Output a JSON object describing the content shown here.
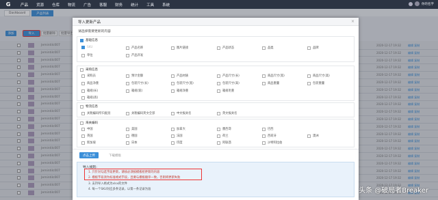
{
  "topnav": {
    "logo": "G",
    "items": [
      "产品",
      "货源",
      "仓库",
      "物流",
      "广告",
      "客服",
      "财务",
      "统计",
      "工具",
      "系统"
    ],
    "user": "你的名字"
  },
  "tabs": [
    "Dashboard",
    "产品列表"
  ],
  "toolbar": {
    "buttons": [
      "添加",
      "导入",
      "批量删除",
      "批量导出"
    ]
  },
  "background_rows": [
    {
      "code": "Jemintilc007",
      "date": "2020-12-17 19:32",
      "ops": "编辑 复制"
    },
    {
      "code": "Jemintilc007",
      "date": "2020-12-17 19:32",
      "ops": "编辑 复制"
    },
    {
      "code": "Jemintilc007",
      "date": "2020-12-17 19:32",
      "ops": "编辑 复制"
    },
    {
      "code": "Jemintilc007",
      "date": "2020-12-17 19:32",
      "ops": "编辑 复制"
    },
    {
      "code": "Jemintilc007",
      "date": "2020-12-17 19:32",
      "ops": "编辑 复制"
    },
    {
      "code": "Jemintilc007",
      "date": "2020-12-17 19:32",
      "ops": "编辑 复制"
    },
    {
      "code": "Jemintilc007",
      "date": "2020-12-17 19:32",
      "ops": "编辑 复制"
    },
    {
      "code": "Jemintilc007",
      "date": "2020-12-17 19:32",
      "ops": "编辑 复制"
    },
    {
      "code": "Jemintilc007",
      "date": "2020-12-17 19:32",
      "ops": "编辑 复制"
    },
    {
      "code": "Jemintilc007",
      "date": "2020-12-17 19:32",
      "ops": "编辑 复制"
    },
    {
      "code": "Jemintilc007",
      "date": "2020-12-17 19:32",
      "ops": "编辑 复制"
    },
    {
      "code": "Jemintilc007",
      "date": "2020-12-17 19:32",
      "ops": "编辑 复制"
    },
    {
      "code": "Jemintilc007",
      "date": "2020-12-17 19:32",
      "ops": "编辑 复制"
    },
    {
      "code": "Jemintilc007",
      "date": "2020-12-17 19:32",
      "ops": "编辑 复制"
    },
    {
      "code": "Jemintilc007",
      "date": "2020-12-17 19:32",
      "ops": "编辑 复制"
    },
    {
      "code": "Jemintilc007",
      "date": "2020-12-17 19:32",
      "ops": "编辑 复制"
    },
    {
      "code": "Jemintilc007",
      "date": "2020-12-17 19:32",
      "ops": "编辑 复制"
    },
    {
      "code": "Jemintilc007",
      "date": "2020-12-17 19:32",
      "ops": "编辑 复制"
    },
    {
      "code": "Jemintilc007",
      "date": "2020-12-17 19:32",
      "ops": "编辑 复制"
    },
    {
      "code": "Jemintilc007",
      "date": "2020-12-17 19:32",
      "ops": "编辑 复制"
    },
    {
      "code": "Jemintilc007",
      "date": "2020-12-17 19:32",
      "ops": "编辑 复制"
    }
  ],
  "modal": {
    "title": "导入更新产品",
    "close": "×",
    "hint": "请选择需要更新的内容",
    "sections": [
      {
        "title": "基础信息",
        "checked": true,
        "fields": [
          {
            "label": "SKU",
            "checked": true,
            "disabled": true
          },
          {
            "label": "产品名称",
            "checked": false
          },
          {
            "label": "图片链接",
            "checked": false
          },
          {
            "label": "产品状态",
            "checked": false
          },
          {
            "label": "品类",
            "checked": false
          },
          {
            "label": "品牌",
            "checked": false
          },
          {
            "label": "单位",
            "checked": false
          },
          {
            "label": "产品开发",
            "checked": false
          }
        ]
      },
      {
        "title": "采购信息",
        "checked": false,
        "fields": [
          {
            "label": "采购员",
            "checked": false
          },
          {
            "label": "预计金额",
            "checked": false
          },
          {
            "label": "产品材质",
            "checked": false
          },
          {
            "label": "产品尺寸(长)",
            "checked": false
          },
          {
            "label": "商品尺寸(宽)",
            "checked": false
          },
          {
            "label": "商品尺寸(高)",
            "checked": false
          },
          {
            "label": "商品净重",
            "checked": false
          },
          {
            "label": "包装尺寸(长)",
            "checked": false
          },
          {
            "label": "包装尺寸(宽)",
            "checked": false
          },
          {
            "label": "包装尺寸(高)",
            "checked": false
          },
          {
            "label": "商品重量",
            "checked": false
          },
          {
            "label": "包装重量",
            "checked": false
          },
          {
            "label": "箱规(长)",
            "checked": false
          },
          {
            "label": "箱规(宽)",
            "checked": false
          },
          {
            "label": "箱规净重",
            "checked": false
          },
          {
            "label": "箱规毛重",
            "checked": false
          },
          {
            "label": "箱规(高)",
            "checked": false
          }
        ]
      },
      {
        "title": "物流信息",
        "checked": false,
        "fields": [
          {
            "label": "关税编码所归类别",
            "checked": false
          },
          {
            "label": "关税编码英文全部",
            "checked": false
          },
          {
            "label": "中文报关名",
            "checked": false
          },
          {
            "label": "英文报关名",
            "checked": false
          }
        ]
      },
      {
        "title": "海关编码",
        "checked": false,
        "fields": [
          {
            "label": "中国",
            "checked": false
          },
          {
            "label": "美国",
            "checked": false
          },
          {
            "label": "加拿大",
            "checked": false
          },
          {
            "label": "墨西哥",
            "checked": false
          },
          {
            "label": "巴西",
            "checked": false
          },
          {
            "label": "英国",
            "checked": false
          },
          {
            "label": "德国",
            "checked": false
          },
          {
            "label": "法国",
            "checked": false
          },
          {
            "label": "荷兰",
            "checked": false
          },
          {
            "label": "西班牙",
            "checked": false
          },
          {
            "label": "澳洲",
            "checked": false
          },
          {
            "label": "新加坡",
            "checked": false
          },
          {
            "label": "日本",
            "checked": false
          },
          {
            "label": "印度",
            "checked": false
          },
          {
            "label": "阿联酋",
            "checked": false
          },
          {
            "label": "沙特阿拉伯",
            "checked": false
          }
        ]
      }
    ],
    "upload_button": "点击上传",
    "download_template": "下载模板",
    "notes_title": "导入规则:",
    "notes": [
      "1. 只针对勾选字段更新，请核必须按模板给更新的内容",
      "2. 模板字段须为标准格式字段，且要与模板顺序一致，否则将更新失败",
      "3. 支持导入格式为xlsx的文件",
      "4. 每一个SKU对应多条记录，以第一条记录为准"
    ]
  },
  "watermark": "头条 @破局者Breaker",
  "colors": {
    "accent": "#3b8fd9",
    "nav": "#2c3443",
    "highlight": "#e33333"
  }
}
